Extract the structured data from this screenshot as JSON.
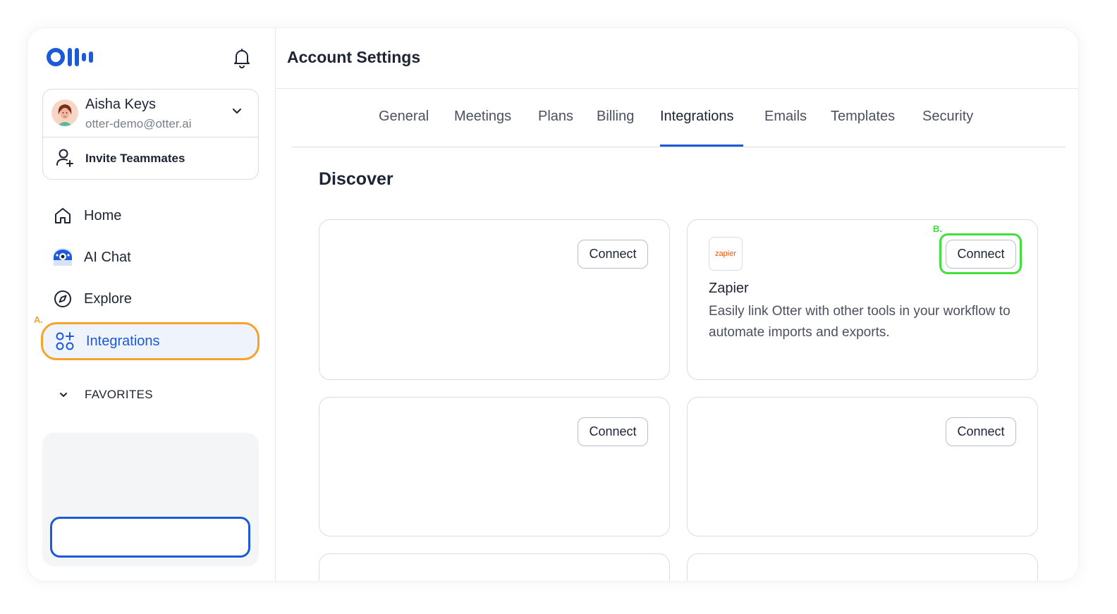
{
  "sidebar": {
    "account": {
      "name": "Aisha Keys",
      "email": "otter-demo@otter.ai",
      "invite_label": "Invite Teammates"
    },
    "nav": {
      "home": "Home",
      "ai_chat": "AI Chat",
      "explore": "Explore",
      "integrations": "Integrations"
    },
    "favorites_label": "FAVORITES",
    "annotation_a": "A."
  },
  "header": {
    "title": "Account Settings"
  },
  "tabs": [
    {
      "label": "General"
    },
    {
      "label": "Meetings"
    },
    {
      "label": "Plans"
    },
    {
      "label": "Billing"
    },
    {
      "label": "Integrations",
      "active": true
    },
    {
      "label": "Emails"
    },
    {
      "label": "Templates"
    },
    {
      "label": "Security"
    }
  ],
  "discover": {
    "title": "Discover",
    "connect_label": "Connect",
    "annotation_b": "B.",
    "zapier": {
      "logo_text": "zapier",
      "name": "Zapier",
      "description": "Easily link Otter with other tools in your workflow to automate imports and exports."
    }
  },
  "colors": {
    "accent": "#1d5ad8",
    "highlight_a": "#f5a32a",
    "highlight_b": "#3fe03a",
    "zapier_brand": "#ff4f00"
  }
}
